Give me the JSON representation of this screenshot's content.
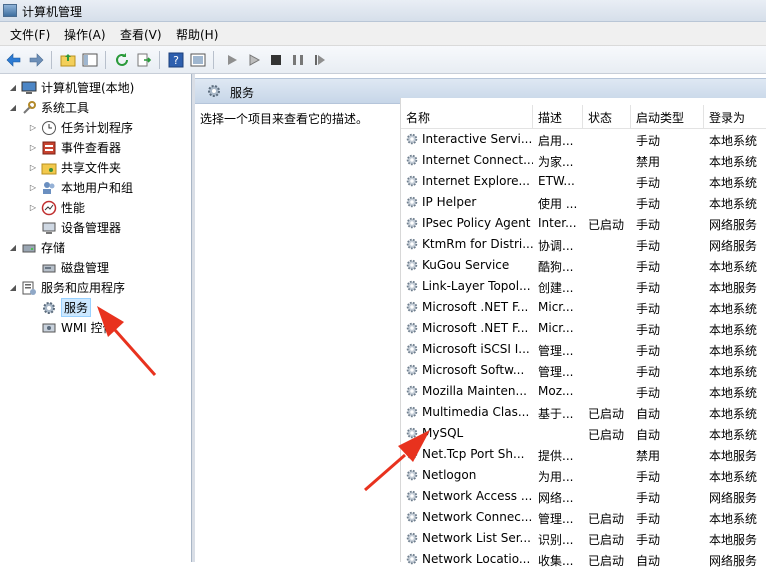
{
  "window": {
    "title": "计算机管理"
  },
  "menu": [
    "文件(F)",
    "操作(A)",
    "查看(V)",
    "帮助(H)"
  ],
  "toolbar": {
    "icons": [
      "back-arrow-icon",
      "forward-arrow-icon",
      "up-folder-icon",
      "show-hide-tree-icon",
      "refresh-icon",
      "export-list-icon",
      "help-icon",
      "properties-icon",
      "play-icon",
      "play-outline-icon",
      "stop-icon",
      "pause-icon",
      "restart-icon"
    ]
  },
  "tree": [
    {
      "label": "计算机管理(本地)",
      "expander": "◢",
      "icon": "computer-icon"
    },
    {
      "label": "系统工具",
      "expander": "◢",
      "icon": "tools-icon"
    },
    {
      "label": "任务计划程序",
      "expander": "▷",
      "icon": "clock-icon"
    },
    {
      "label": "事件查看器",
      "expander": "▷",
      "icon": "event-viewer-icon"
    },
    {
      "label": "共享文件夹",
      "expander": "▷",
      "icon": "shared-folder-icon"
    },
    {
      "label": "本地用户和组",
      "expander": "▷",
      "icon": "users-icon"
    },
    {
      "label": "性能",
      "expander": "▷",
      "icon": "performance-icon"
    },
    {
      "label": "设备管理器",
      "expander": "",
      "icon": "device-manager-icon"
    },
    {
      "label": "存储",
      "expander": "◢",
      "icon": "storage-icon"
    },
    {
      "label": "磁盘管理",
      "expander": "",
      "icon": "disk-icon"
    },
    {
      "label": "服务和应用程序",
      "expander": "◢",
      "icon": "services-apps-icon"
    },
    {
      "label": "服务",
      "expander": "",
      "icon": "gear-icon"
    },
    {
      "label": "WMI 控件",
      "expander": "",
      "icon": "wmi-icon"
    }
  ],
  "pane": {
    "title": "服务",
    "description": "选择一个项目来查看它的描述。"
  },
  "columns": [
    "名称",
    "描述",
    "状态",
    "启动类型",
    "登录为"
  ],
  "services": [
    [
      "Interactive Servi...",
      "启用...",
      "",
      "手动",
      "本地系统"
    ],
    [
      "Internet Connect...",
      "为家...",
      "",
      "禁用",
      "本地系统"
    ],
    [
      "Internet Explore...",
      "ETW...",
      "",
      "手动",
      "本地系统"
    ],
    [
      "IP Helper",
      "使用 ...",
      "",
      "手动",
      "本地系统"
    ],
    [
      "IPsec Policy Agent",
      "Inter...",
      "已启动",
      "手动",
      "网络服务"
    ],
    [
      "KtmRm for Distri...",
      "协调...",
      "",
      "手动",
      "网络服务"
    ],
    [
      "KuGou Service",
      "酷狗...",
      "",
      "手动",
      "本地系统"
    ],
    [
      "Link-Layer Topol...",
      "创建...",
      "",
      "手动",
      "本地服务"
    ],
    [
      "Microsoft .NET F...",
      "Micr...",
      "",
      "手动",
      "本地系统"
    ],
    [
      "Microsoft .NET F...",
      "Micr...",
      "",
      "手动",
      "本地系统"
    ],
    [
      "Microsoft iSCSI I...",
      "管理...",
      "",
      "手动",
      "本地系统"
    ],
    [
      "Microsoft Softw...",
      "管理...",
      "",
      "手动",
      "本地系统"
    ],
    [
      "Mozilla Mainten...",
      "Moz...",
      "",
      "手动",
      "本地系统"
    ],
    [
      "Multimedia Clas...",
      "基于...",
      "已启动",
      "自动",
      "本地系统"
    ],
    [
      "MySQL",
      "",
      "已启动",
      "自动",
      "本地系统"
    ],
    [
      "Net.Tcp Port Sh...",
      "提供...",
      "",
      "禁用",
      "本地服务"
    ],
    [
      "Netlogon",
      "为用...",
      "",
      "手动",
      "本地系统"
    ],
    [
      "Network Access ...",
      "网络...",
      "",
      "手动",
      "网络服务"
    ],
    [
      "Network Connec...",
      "管理...",
      "已启动",
      "手动",
      "本地系统"
    ],
    [
      "Network List Ser...",
      "识别...",
      "已启动",
      "手动",
      "本地服务"
    ],
    [
      "Network Locatio...",
      "收集...",
      "已启动",
      "自动",
      "网络服务"
    ]
  ]
}
